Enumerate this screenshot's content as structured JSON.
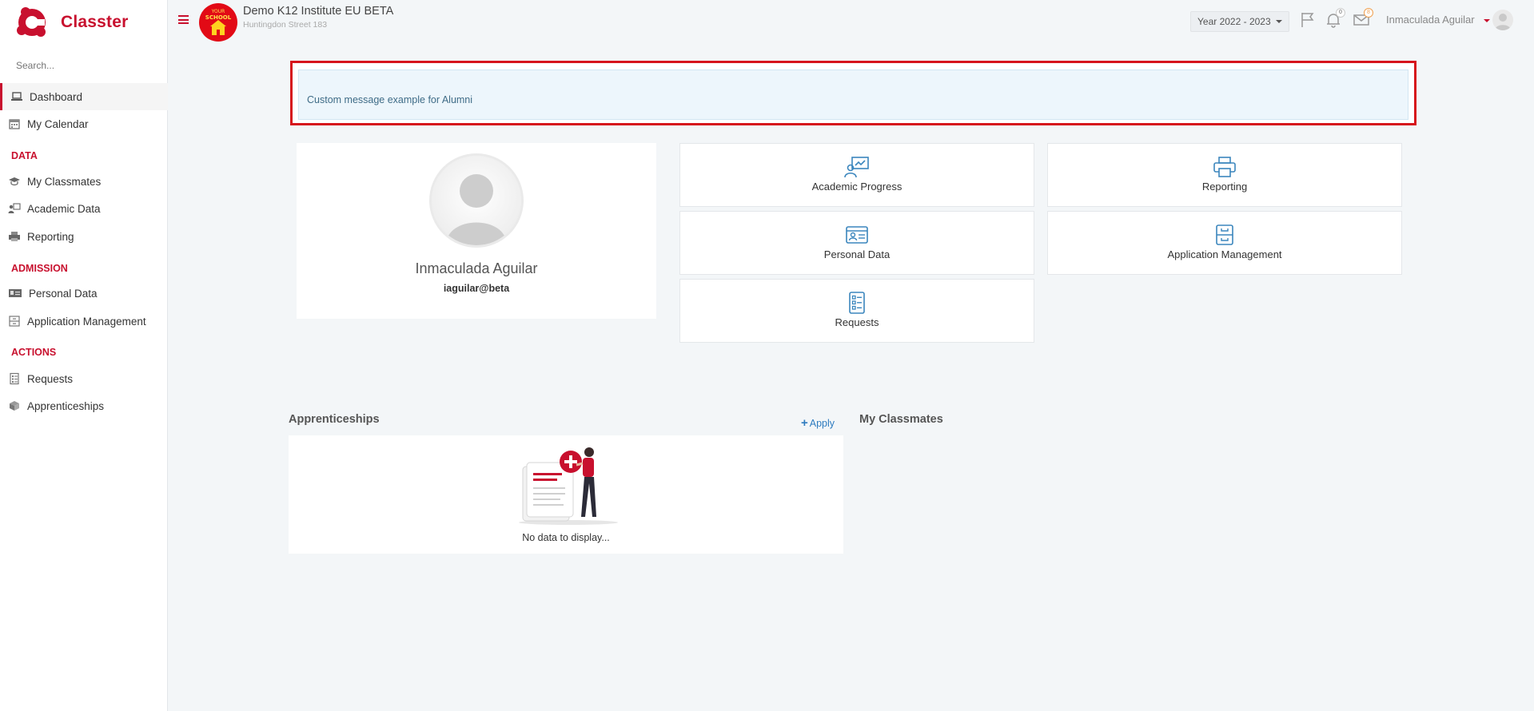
{
  "app": {
    "brand": "Classter"
  },
  "sidebar": {
    "search_placeholder": "Search...",
    "items": [
      {
        "label": "Dashboard"
      },
      {
        "label": "My Calendar"
      }
    ],
    "sections": [
      {
        "title": "DATA",
        "items": [
          {
            "label": "My Classmates"
          },
          {
            "label": "Academic Data"
          },
          {
            "label": "Reporting"
          }
        ]
      },
      {
        "title": "ADMISSION",
        "items": [
          {
            "label": "Personal Data"
          },
          {
            "label": "Application Management"
          }
        ]
      },
      {
        "title": "ACTIONS",
        "items": [
          {
            "label": "Requests"
          },
          {
            "label": "Apprenticeships"
          }
        ]
      }
    ]
  },
  "header": {
    "school_name": "Demo K12 Institute EU BETA",
    "school_address": "Huntingdon Street 183",
    "school_logo_text": "YOUR SCHOOL",
    "year": "Year 2022 - 2023",
    "notifications_count": "0",
    "messages_count": "8",
    "user_name": "Inmaculada Aguilar"
  },
  "message": {
    "text": "Custom message example for Alumni"
  },
  "profile": {
    "name": "Inmaculada Aguilar",
    "email": "iaguilar@beta"
  },
  "tiles": [
    {
      "label": "Academic Progress"
    },
    {
      "label": "Reporting"
    },
    {
      "label": "Personal Data"
    },
    {
      "label": "Application Management"
    },
    {
      "label": "Requests"
    }
  ],
  "apprenticeships": {
    "title": "Apprenticeships",
    "apply_label": "Apply",
    "empty_text": "No data to display..."
  },
  "classmates": {
    "title": "My Classmates"
  },
  "colors": {
    "brand_red": "#c8102e",
    "link_blue": "#2d7bbf",
    "tile_icon_blue": "#3b86bd"
  }
}
